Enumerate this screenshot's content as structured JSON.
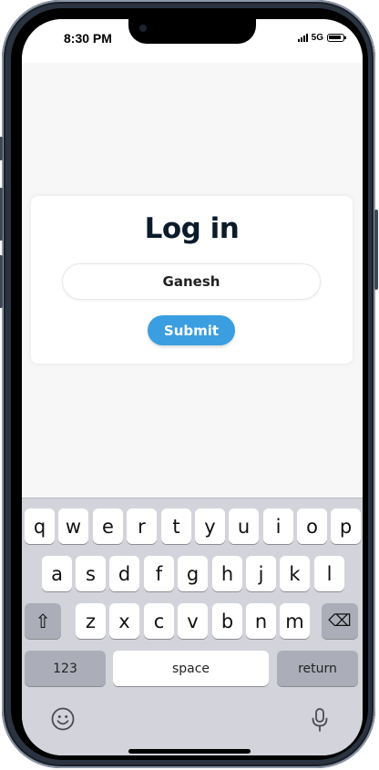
{
  "status_bar": {
    "time": "8:30 PM",
    "network": "5G"
  },
  "login": {
    "title": "Log in",
    "username_value": "Ganesh",
    "submit_label": "Submit"
  },
  "keyboard": {
    "row1": [
      "q",
      "w",
      "e",
      "r",
      "t",
      "y",
      "u",
      "i",
      "o",
      "p"
    ],
    "row2": [
      "a",
      "s",
      "d",
      "f",
      "g",
      "h",
      "j",
      "k",
      "l"
    ],
    "row3": [
      "z",
      "x",
      "c",
      "v",
      "b",
      "n",
      "m"
    ],
    "shift_glyph": "⇧",
    "delete_glyph": "⌫",
    "numbers_label": "123",
    "space_label": "space",
    "return_label": "return"
  },
  "icons": {
    "emoji": "emoji-icon",
    "microphone": "microphone-icon",
    "signal": "signal-icon",
    "battery": "battery-icon"
  },
  "colors": {
    "accent": "#3a9ee0",
    "screen_bg": "#f7f7f7",
    "keyboard_bg": "#d3d4db",
    "title": "#0b1b2b"
  }
}
